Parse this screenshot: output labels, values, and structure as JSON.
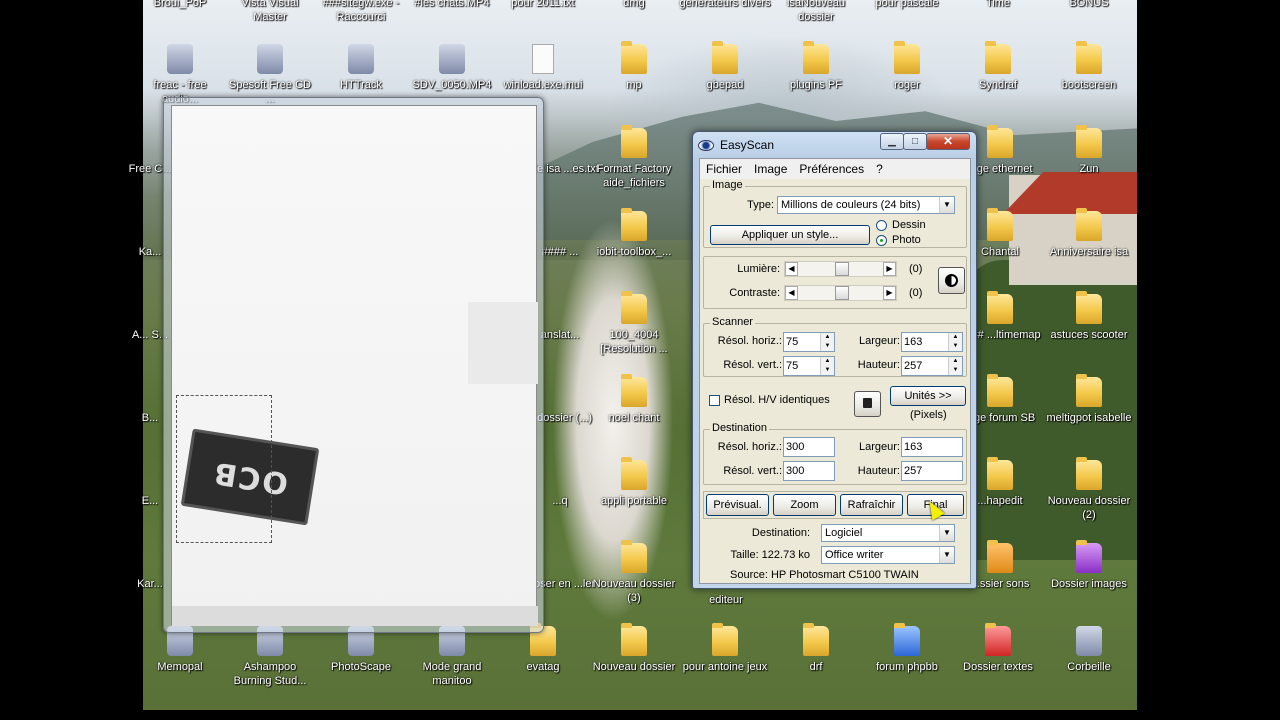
{
  "desktop": {
    "top_row": [
      "Broui_PoP",
      "Vista Visual Master",
      "###sitegw.exe - Raccourci",
      "#les chats.MP4",
      "pour 2011.txt",
      "dmg",
      "générateurs divers",
      "isaNouveau dossier",
      "pour pascale",
      "Time",
      "BONUS"
    ],
    "row1": [
      "freac - free audio...",
      "Spesoft Free CD ...",
      "HTTrack",
      "SDV_0050.MP4",
      "winload.exe.mui",
      "mp",
      "gbepad",
      "plugins PF",
      "roger",
      "Syndraf",
      "bootscreen"
    ],
    "col_left_partial": [
      "Free C...",
      "Ka...",
      "A... S...",
      "B...",
      "E...",
      "Kar..."
    ],
    "col_mid": [
      "arde isa ...es.txt",
      "#### ...",
      "anslat...",
      "u dossier (...)",
      "...q",
      "...oser en ...ler"
    ],
    "col_mid2": [
      "Format Factory aide_fichiers",
      "iobit-toolbox_...",
      "100_4004 [Resolution ...",
      "noel chant",
      "appli portable",
      "Nouveau dossier (3)"
    ],
    "col_right1": [
      "...ge ethernet",
      "Chantal",
      "#### ...ltimemap",
      "...ge forum SB",
      "...hapedit",
      "...ssier sons"
    ],
    "col_right2": [
      "Zun",
      "Anniversaire isa",
      "astuces scooter",
      "meltigpot isabelle",
      "Nouveau dossier (2)",
      "Dossier images"
    ],
    "editeur": "editeur",
    "bottom_row": [
      "Memopal",
      "Ashampoo Burning Stud...",
      "PhotoScape",
      "Mode grand manitoo",
      "evatag",
      "Nouveau dossier",
      "pour antoine jeux",
      "drf",
      "forum phpbb",
      "Dossier textes",
      "Corbeille"
    ]
  },
  "preview": {
    "card_text": "OCB"
  },
  "easyscan": {
    "title": "EasyScan",
    "caption_buttons": {
      "min": "▁",
      "max": "□",
      "close": "✕"
    },
    "menu": [
      "Fichier",
      "Image",
      "Préférences",
      "?"
    ],
    "image_group": {
      "label": "Image",
      "type_label": "Type:",
      "type_value": "Millions de couleurs (24 bits)",
      "style_button": "Appliquer un style...",
      "radio_dessin": "Dessin",
      "radio_photo": "Photo"
    },
    "adjust": {
      "lumiere_label": "Lumière:",
      "lumiere_value": "(0)",
      "contraste_label": "Contraste:",
      "contraste_value": "(0)",
      "lumiere_level": 0.5,
      "contraste_level": 0.5
    },
    "scanner": {
      "label": "Scanner",
      "res_h_label": "Résol. horiz.:",
      "res_h": "75",
      "res_v_label": "Résol. vert.:",
      "res_v": "75",
      "largeur_label": "Largeur:",
      "largeur": "163",
      "hauteur_label": "Hauteur:",
      "hauteur": "257"
    },
    "identical_label": "Résol. H/V identiques",
    "units_button": "Unités >>",
    "units_value": "(Pixels)",
    "destination_group": {
      "label": "Destination",
      "res_h_label": "Résol. horiz.:",
      "res_h": "300",
      "res_v_label": "Résol. vert.:",
      "res_v": "300",
      "largeur_label": "Largeur:",
      "largeur": "163",
      "hauteur_label": "Hauteur:",
      "hauteur": "257"
    },
    "buttons": {
      "previsual": "Prévisual.",
      "zoom": "Zoom",
      "rafraichir": "Rafraîchir",
      "final": "Final"
    },
    "dest_label": "Destination:",
    "dest_value": "Logiciel",
    "taille_label": "Taille: 122.73 ko",
    "taille_value": "Office writer",
    "source": "Source:  HP Photosmart C5100 TWAIN"
  }
}
